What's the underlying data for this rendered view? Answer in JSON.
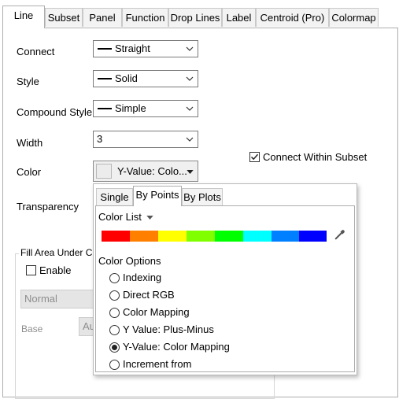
{
  "tabs": [
    "Line",
    "Subset",
    "Panel",
    "Function",
    "Drop Lines",
    "Label",
    "Centroid (Pro)",
    "Colormap"
  ],
  "fields": {
    "connect_label": "Connect",
    "connect_value": "Straight",
    "style_label": "Style",
    "style_value": "Solid",
    "compound_label": "Compound Style",
    "compound_value": "Simple",
    "width_label": "Width",
    "width_value": "3",
    "color_label": "Color",
    "color_value": "Y-Value: Colo...",
    "transparency_label": "Transparency",
    "connect_within_subset": "Connect Within Subset"
  },
  "fill_area": {
    "group_label": "Fill Area Under Cu",
    "enable_label": "Enable",
    "mode_value": "Normal",
    "base_label": "Base",
    "base_value": "Au"
  },
  "color_popup": {
    "tabs": [
      "Single",
      "By Points",
      "By Plots"
    ],
    "color_list_label": "Color List",
    "color_list": [
      "#ff0000",
      "#ff8000",
      "#ffff00",
      "#80ff00",
      "#00ff00",
      "#00ffff",
      "#0080ff",
      "#0000ff"
    ],
    "options_label": "Color Options",
    "options": [
      "Indexing",
      "Direct RGB",
      "Color Mapping",
      "Y Value: Plus-Minus",
      "Y-Value: Color Mapping",
      "Increment from"
    ],
    "selected_option": "Y-Value: Color Mapping"
  },
  "colors": {
    "combo_border": "#7a7a7a",
    "tab_active_bg": "#ffffff",
    "tab_inactive_bg": "#f3f3f3"
  }
}
